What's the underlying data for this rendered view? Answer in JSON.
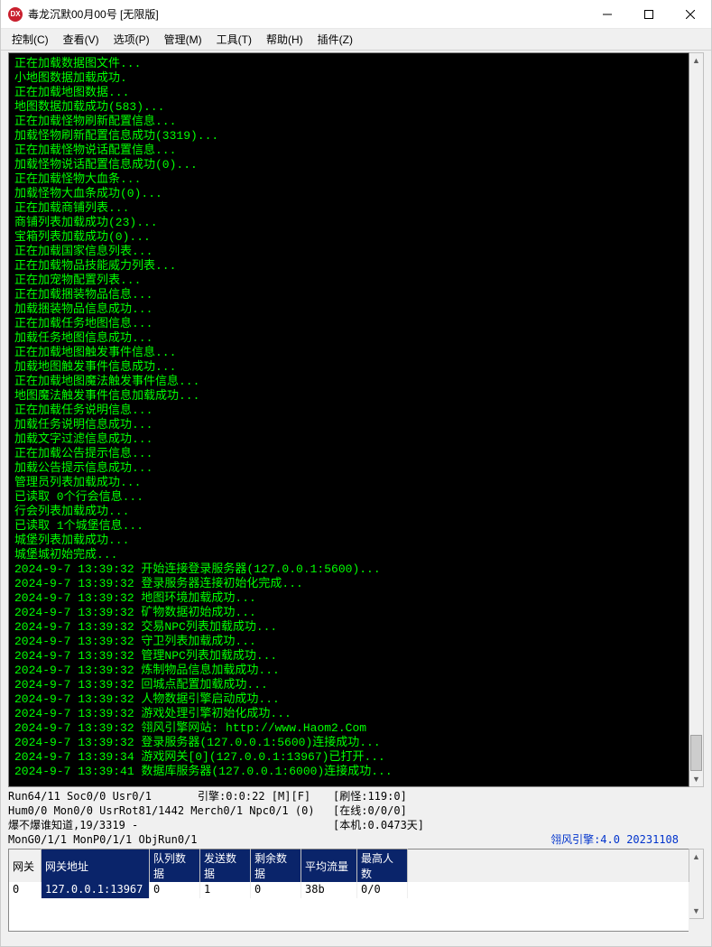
{
  "window": {
    "title": "毒龙沉默00月00号 [无限版]",
    "icon_text": "DX"
  },
  "win_controls": {
    "min": "minimize",
    "max": "maximize",
    "close": "close"
  },
  "menu": [
    "控制(C)",
    "查看(V)",
    "选项(P)",
    "管理(M)",
    "工具(T)",
    "帮助(H)",
    "插件(Z)"
  ],
  "console_lines": [
    "正在加载数据图文件...",
    "小地图数据加载成功.",
    "正在加载地图数据...",
    "地图数据加载成功(583)...",
    "正在加载怪物刷新配置信息...",
    "加载怪物刷新配置信息成功(3319)...",
    "正在加载怪物说话配置信息...",
    "加载怪物说话配置信息成功(0)...",
    "正在加载怪物大血条...",
    "加载怪物大血条成功(0)...",
    "正在加载商铺列表...",
    "商铺列表加载成功(23)...",
    "宝箱列表加载成功(0)...",
    "正在加载国家信息列表...",
    "正在加载物品技能威力列表...",
    "正在加宠物配置列表...",
    "正在加载捆装物品信息...",
    "加载捆装物品信息成功...",
    "正在加载任务地图信息...",
    "加载任务地图信息成功...",
    "正在加载地图触发事件信息...",
    "加载地图触发事件信息成功...",
    "正在加载地图魔法触发事件信息...",
    "地图魔法触发事件信息加载成功...",
    "正在加载任务说明信息...",
    "加载任务说明信息成功...",
    "加载文字过滤信息成功...",
    "正在加载公告提示信息...",
    "加载公告提示信息成功...",
    "管理员列表加载成功...",
    "已读取 0个行会信息...",
    "行会列表加载成功...",
    "已读取 1个城堡信息...",
    "城堡列表加载成功...",
    "城堡城初始完成...",
    "2024-9-7 13:39:32 开始连接登录服务器(127.0.0.1:5600)...",
    "2024-9-7 13:39:32 登录服务器连接初始化完成...",
    "2024-9-7 13:39:32 地图环境加载成功...",
    "2024-9-7 13:39:32 矿物数据初始成功...",
    "2024-9-7 13:39:32 交易NPC列表加载成功...",
    "2024-9-7 13:39:32 守卫列表加载成功...",
    "2024-9-7 13:39:32 管理NPC列表加载成功...",
    "2024-9-7 13:39:32 炼制物品信息加载成功...",
    "2024-9-7 13:39:32 回城点配置加载成功...",
    "2024-9-7 13:39:32 人物数据引擎启动成功...",
    "2024-9-7 13:39:32 游戏处理引擎初始化成功...",
    "2024-9-7 13:39:32 翎风引擎网站: http://www.Haom2.Com",
    "2024-9-7 13:39:32 登录服务器(127.0.0.1:5600)连接成功...",
    "2024-9-7 13:39:34 游戏网关[0](127.0.0.1:13967)已打开...",
    "2024-9-7 13:39:41 数据库服务器(127.0.0.1:6000)连接成功..."
  ],
  "status": {
    "row1_left": "Run64/11 Soc0/0 Usr0/1",
    "row1_mid": "引擎:0:0:22 [M][F]",
    "row1_right": "[刷怪:119:0]",
    "row2_left": "Hum0/0 Mon0/0 UsrRot81/1442 Merch0/1 Npc0/1 (0)",
    "row2_right": "[在线:0/0/0]",
    "row3_left": "爆不爆谁知道,19/3319 -",
    "row3_right": "[本机:0.0473天]",
    "row4_left": "MonG0/1/1 MonP0/1/1 ObjRun0/1",
    "engine": "翎风引擎:4.0 20231108"
  },
  "table": {
    "headers": [
      "网关",
      "网关地址",
      "队列数据",
      "发送数据",
      "剩余数据",
      "平均流量",
      "最高人数"
    ],
    "row": [
      "0",
      "127.0.0.1:13967",
      "0",
      "1",
      "0",
      "38b",
      "0/0"
    ]
  }
}
